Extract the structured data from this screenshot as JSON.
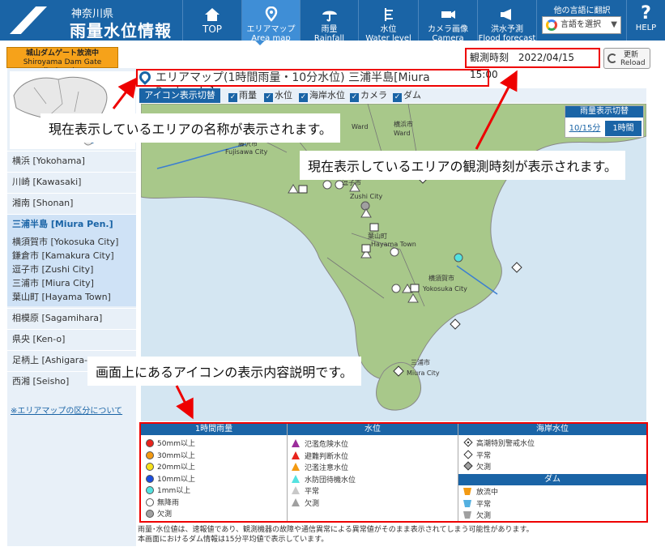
{
  "header": {
    "prefecture": "神奈川県",
    "title": "雨量水位情報",
    "nav": [
      {
        "ja": "TOP",
        "en": ""
      },
      {
        "ja": "エリアマップ",
        "en": "Area map"
      },
      {
        "ja": "雨量",
        "en": "Rainfall"
      },
      {
        "ja": "水位",
        "en": "Water level"
      },
      {
        "ja": "カメラ画像",
        "en": "Camera image"
      },
      {
        "ja": "洪水予測",
        "en": "Flood forecast"
      }
    ],
    "lang_title": "他の言語に翻訳",
    "lang_select": "言語を選択",
    "help": "HELP"
  },
  "dam_button": {
    "ja": "城山ダムゲート放流中",
    "en": "Shiroyama Dam Gate discharging"
  },
  "sidebar": {
    "areas_top": [
      "横浜 [Yokohama]",
      "川崎 [Kawasaki]",
      "湘南 [Shonan]"
    ],
    "current": "三浦半島 [Miura Pen.]",
    "sub": [
      "横須賀市 [Yokosuka City]",
      "鎌倉市 [Kamakura City]",
      "逗子市 [Zushi City]",
      "三浦市 [Miura City]",
      "葉山町 [Hayama Town]"
    ],
    "areas_bottom": [
      "相模原 [Sagamihara]",
      "県央 [Ken-o]",
      "足柄上 [Ashigara-",
      "西湘 [Seisho]"
    ],
    "link": "※エリアマップの区分について"
  },
  "area_title": "エリアマップ(1時間雨量・10分水位) 三浦半島[Miura Peninsula]",
  "observation": {
    "label": "観測時刻",
    "value": "2022/04/15 15:00"
  },
  "reload": {
    "ja": "更新",
    "en": "Reload"
  },
  "icon_toggle": {
    "label": "アイコン表示切替",
    "items": [
      "雨量",
      "水位",
      "海岸水位",
      "カメラ",
      "ダム"
    ]
  },
  "rain_toggle": {
    "title": "雨量表示切替",
    "opt1": "10/15分",
    "opt2": "1時間"
  },
  "map_labels": {
    "ward1": "Ward",
    "ward2": "横浜市",
    "ward3": "Ward",
    "fuj_ja": "藤沢市",
    "fuj_en": "Fujisawa City",
    "zushi_ja": "逗子市",
    "zushi_en": "Zushi City",
    "hayama_ja": "葉山町",
    "hayama_en": "Hayama Town",
    "yoko_ja": "横須賀市",
    "yoko_en": "Yokosuka City",
    "miura_ja": "三浦市",
    "miura_en": "Miura City",
    "kama": "鎌倉市"
  },
  "legend": {
    "rain_title": "1時間雨量",
    "rain": [
      "50mm以上",
      "30mm以上",
      "20mm以上",
      "10mm以上",
      "1mm以上",
      "無降雨",
      "欠測"
    ],
    "rain_colors": [
      "#e8231c",
      "#f39a12",
      "#f7e11b",
      "#1b4ee0",
      "#53e2e0",
      "#ffffff",
      "#a0a0a0"
    ],
    "water_title": "水位",
    "water": [
      "氾濫危険水位",
      "避難判断水位",
      "氾濫注意水位",
      "水防団待機水位",
      "平常",
      "欠測"
    ],
    "water_colors": [
      "#9b2d9b",
      "#e8231c",
      "#f39a12",
      "#53e2e0",
      "#ffffff",
      "#a0a0a0"
    ],
    "coast_title": "海岸水位",
    "coast": [
      "高潮特別警戒水位",
      "平常",
      "欠測"
    ],
    "dam_title": "ダム",
    "dam": [
      "放流中",
      "平常",
      "欠測"
    ],
    "dam_colors": [
      "#f39a12",
      "#53b0e0",
      "#a0a0a0"
    ]
  },
  "note": [
    "雨量･水位値は、速報値であり、観測機器の故障や通信異常による異常値がそのまま表示されてしまう可能性があります。",
    "本画面におけるダム情報は15分平均値で表示しています。"
  ],
  "callouts": [
    "現在表示しているエリアの名称が表示されます。",
    "現在表示しているエリアの観測時刻が表示されます。",
    "画面上にあるアイコンの表示内容説明です。"
  ]
}
